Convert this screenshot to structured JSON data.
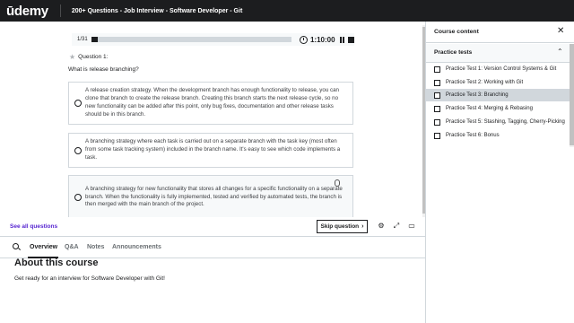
{
  "header": {
    "logo": "ūdemy",
    "course_title": "200+ Questions - Job Interview - Software Developer - Git"
  },
  "quiz": {
    "progress_text": "1/31",
    "progress_fraction": 0.032,
    "timer": "1:10:00",
    "question_label": "Question 1:",
    "question_text": "What is release branching?",
    "options": [
      {
        "text": "A release creation strategy. When the development branch has enough functionality to release, you can clone that branch to create the release branch. Creating this branch starts the next release cycle, so no new functionality can be added after this point, only bug fixes, documentation and other release tasks should be in this branch."
      },
      {
        "text": "A branching strategy where each task is carried out on a separate branch with the task key (most often from some task tracking system) included in the branch name. It's easy to see which code implements a task."
      },
      {
        "text": "A branching strategy for new functionality that stores all changes for a specific functionality on a separate branch. When the functionality is fully implemented, tested and verified by automated tests, the branch is then merged with the main branch of the project."
      }
    ]
  },
  "footer": {
    "see_all": "See all questions",
    "skip_label": "Skip question",
    "skip_chevron": "›"
  },
  "tabs": [
    {
      "label": "Overview"
    },
    {
      "label": "Q&A"
    },
    {
      "label": "Notes"
    },
    {
      "label": "Announcements"
    }
  ],
  "about": {
    "title": "About this course",
    "description": "Get ready for an interview for Software Developer with Git!"
  },
  "sidebar": {
    "title": "Course content",
    "close": "✕",
    "section_title": "Practice tests",
    "section_chevron": "⌃",
    "items": [
      {
        "label": "Practice Test 1: Version Control Systems & Git"
      },
      {
        "label": "Practice Test 2: Working with Git"
      },
      {
        "label": "Practice Test 3: Branching"
      },
      {
        "label": "Practice Test 4: Merging & Rebasing"
      },
      {
        "label": "Practice Test 5: Stashing, Tagging, Cherry-Picking"
      },
      {
        "label": "Practice Test 6: Bonus"
      }
    ]
  }
}
